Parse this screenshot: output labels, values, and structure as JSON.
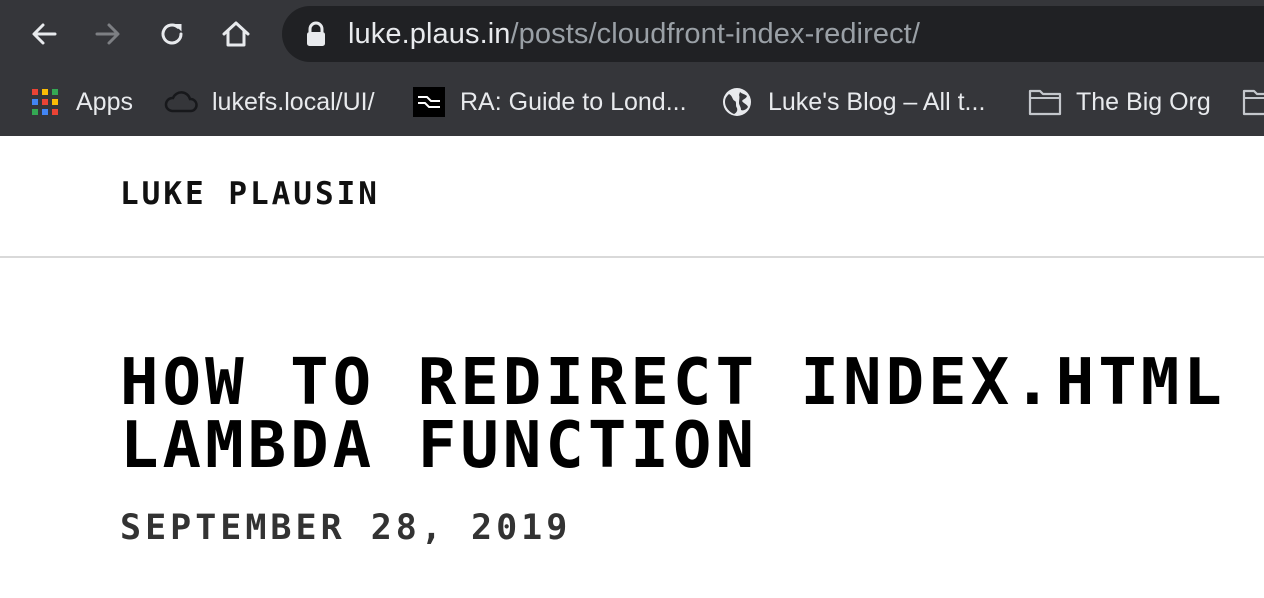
{
  "browser": {
    "url_host": "luke.plaus.in",
    "url_path": "/posts/cloudfront-index-redirect/"
  },
  "bookmarks": [
    {
      "label": "Apps",
      "icon": "apps-grid-icon"
    },
    {
      "label": "lukefs.local/UI/",
      "icon": "cloud-icon"
    },
    {
      "label": "RA: Guide to Lond...",
      "icon": "ra-logo-icon"
    },
    {
      "label": "Luke's Blog – All t...",
      "icon": "globe-icon"
    },
    {
      "label": "The Big Org",
      "icon": "folder-icon"
    }
  ],
  "site": {
    "title": "LUKE PLAUSIN"
  },
  "post": {
    "title_line1": "HOW TO REDIRECT INDEX.HTML",
    "title_line2": "LAMBDA FUNCTION",
    "date": "SEPTEMBER 28, 2019"
  },
  "colors": {
    "chrome_bg": "#35363a",
    "omnibox_bg": "#202124",
    "url_host": "#e8eaed",
    "url_path": "#9aa0a6"
  }
}
